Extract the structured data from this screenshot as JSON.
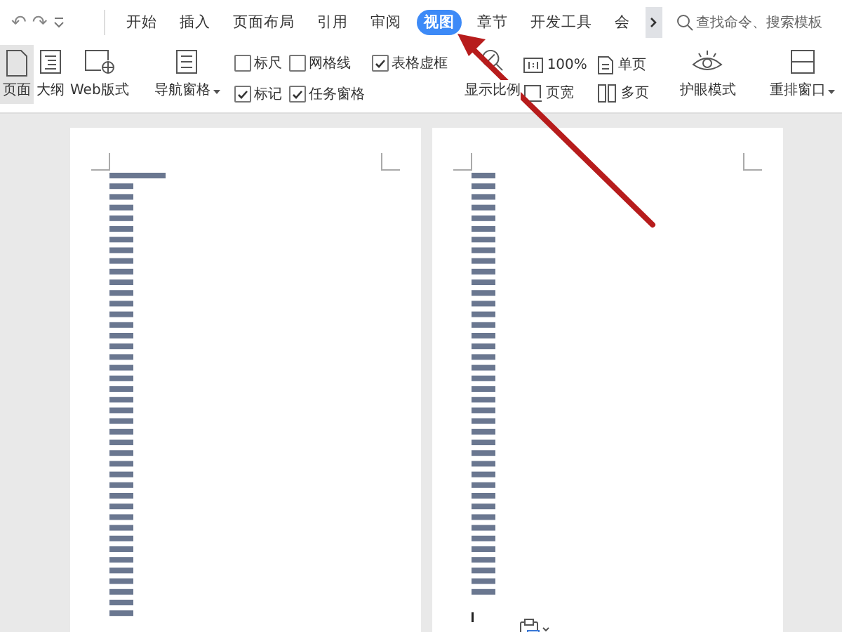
{
  "quick_access": {
    "undo": "↶",
    "redo": "↷"
  },
  "tabs": [
    {
      "label": "开始",
      "selected": false
    },
    {
      "label": "插入",
      "selected": false
    },
    {
      "label": "页面布局",
      "selected": false
    },
    {
      "label": "引用",
      "selected": false
    },
    {
      "label": "审阅",
      "selected": false
    },
    {
      "label": "视图",
      "selected": true
    },
    {
      "label": "章节",
      "selected": false
    },
    {
      "label": "开发工具",
      "selected": false
    },
    {
      "label": "会",
      "selected": false
    }
  ],
  "search": {
    "placeholder": "查找命令、搜索模板"
  },
  "view_modes": [
    {
      "label": "页面",
      "kind": "page",
      "selected": true
    },
    {
      "label": "大纲",
      "kind": "outline",
      "selected": false
    },
    {
      "label": "Web版式",
      "kind": "web",
      "selected": false
    }
  ],
  "navigation_pane": {
    "label": "导航窗格"
  },
  "checkboxes": [
    {
      "label": "标尺",
      "checked": false
    },
    {
      "label": "网格线",
      "checked": false
    },
    {
      "label": "表格虚框",
      "checked": true
    },
    {
      "label": "标记",
      "checked": true
    },
    {
      "label": "任务窗格",
      "checked": true
    }
  ],
  "zoom": {
    "label": "显示比例"
  },
  "zoom_options": [
    {
      "label": "100%",
      "kind": "hundred"
    },
    {
      "label": "单页",
      "kind": "single"
    },
    {
      "label": "页宽",
      "kind": "width"
    },
    {
      "label": "多页",
      "kind": "multi"
    }
  ],
  "eye_mode": {
    "label": "护眼模式"
  },
  "rearrange": {
    "label": "重排窗口"
  }
}
